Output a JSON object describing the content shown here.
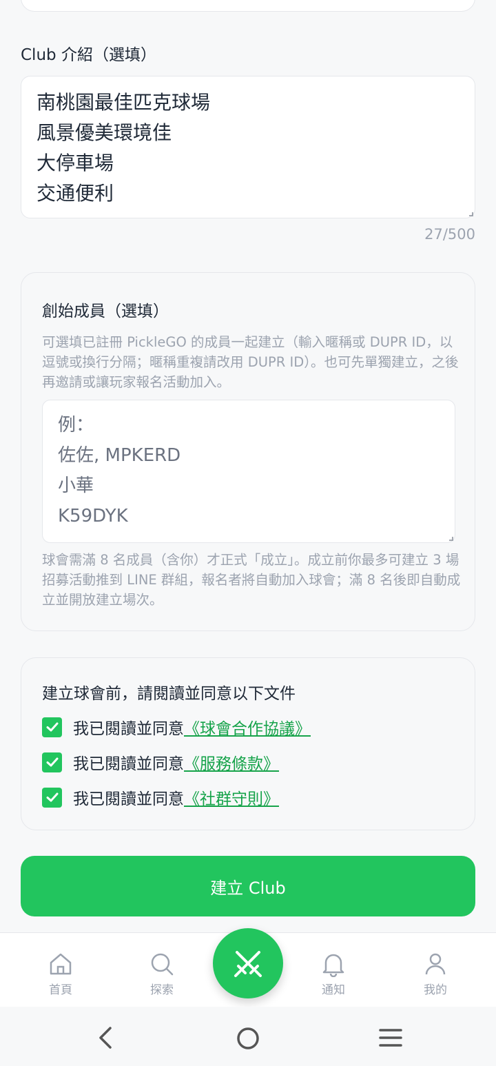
{
  "intro": {
    "label": "Club 介紹（選填）",
    "lines": [
      "南桃園最佳匹克球場",
      "風景優美環境佳",
      "大停車場",
      "交通便利"
    ],
    "count": "27/500"
  },
  "founders": {
    "title": "創始成員（選填）",
    "description": "可選填已註冊 PickleGO 的成員一起建立（輸入暱稱或 DUPR ID，以逗號或換行分隔；暱稱重複請改用 DUPR ID）。也可先單獨建立，之後再邀請或讓玩家報名活動加入。",
    "placeholder_lines": [
      "例：",
      "佐佐, MPKERD",
      "小華",
      "K59DYK"
    ],
    "note": "球會需滿 8 名成員（含你）才正式「成立」。成立前你最多可建立 3 場招募活動推到 LINE 群組，報名者將自動加入球會；滿 8 名後即自動成立並開放建立場次。"
  },
  "agreements": {
    "title": "建立球會前，請閱讀並同意以下文件",
    "items": [
      {
        "prefix": "我已閱讀並同意",
        "link": "《球會合作協議》",
        "checked": true
      },
      {
        "prefix": "我已閱讀並同意",
        "link": "《服務條款》",
        "checked": true
      },
      {
        "prefix": "我已閱讀並同意",
        "link": "《社群守則》",
        "checked": true
      }
    ]
  },
  "create_button": "建立 Club",
  "nav": {
    "items": [
      {
        "label": "首頁",
        "icon": "home-icon"
      },
      {
        "label": "探索",
        "icon": "search-icon"
      },
      {
        "label": "",
        "icon": "crossed-swords-icon"
      },
      {
        "label": "通知",
        "icon": "bell-icon"
      },
      {
        "label": "我的",
        "icon": "user-icon"
      }
    ]
  },
  "colors": {
    "accent": "#22c55e",
    "link": "#16a34a",
    "muted": "#9ca3af",
    "border": "#e5e7eb"
  }
}
